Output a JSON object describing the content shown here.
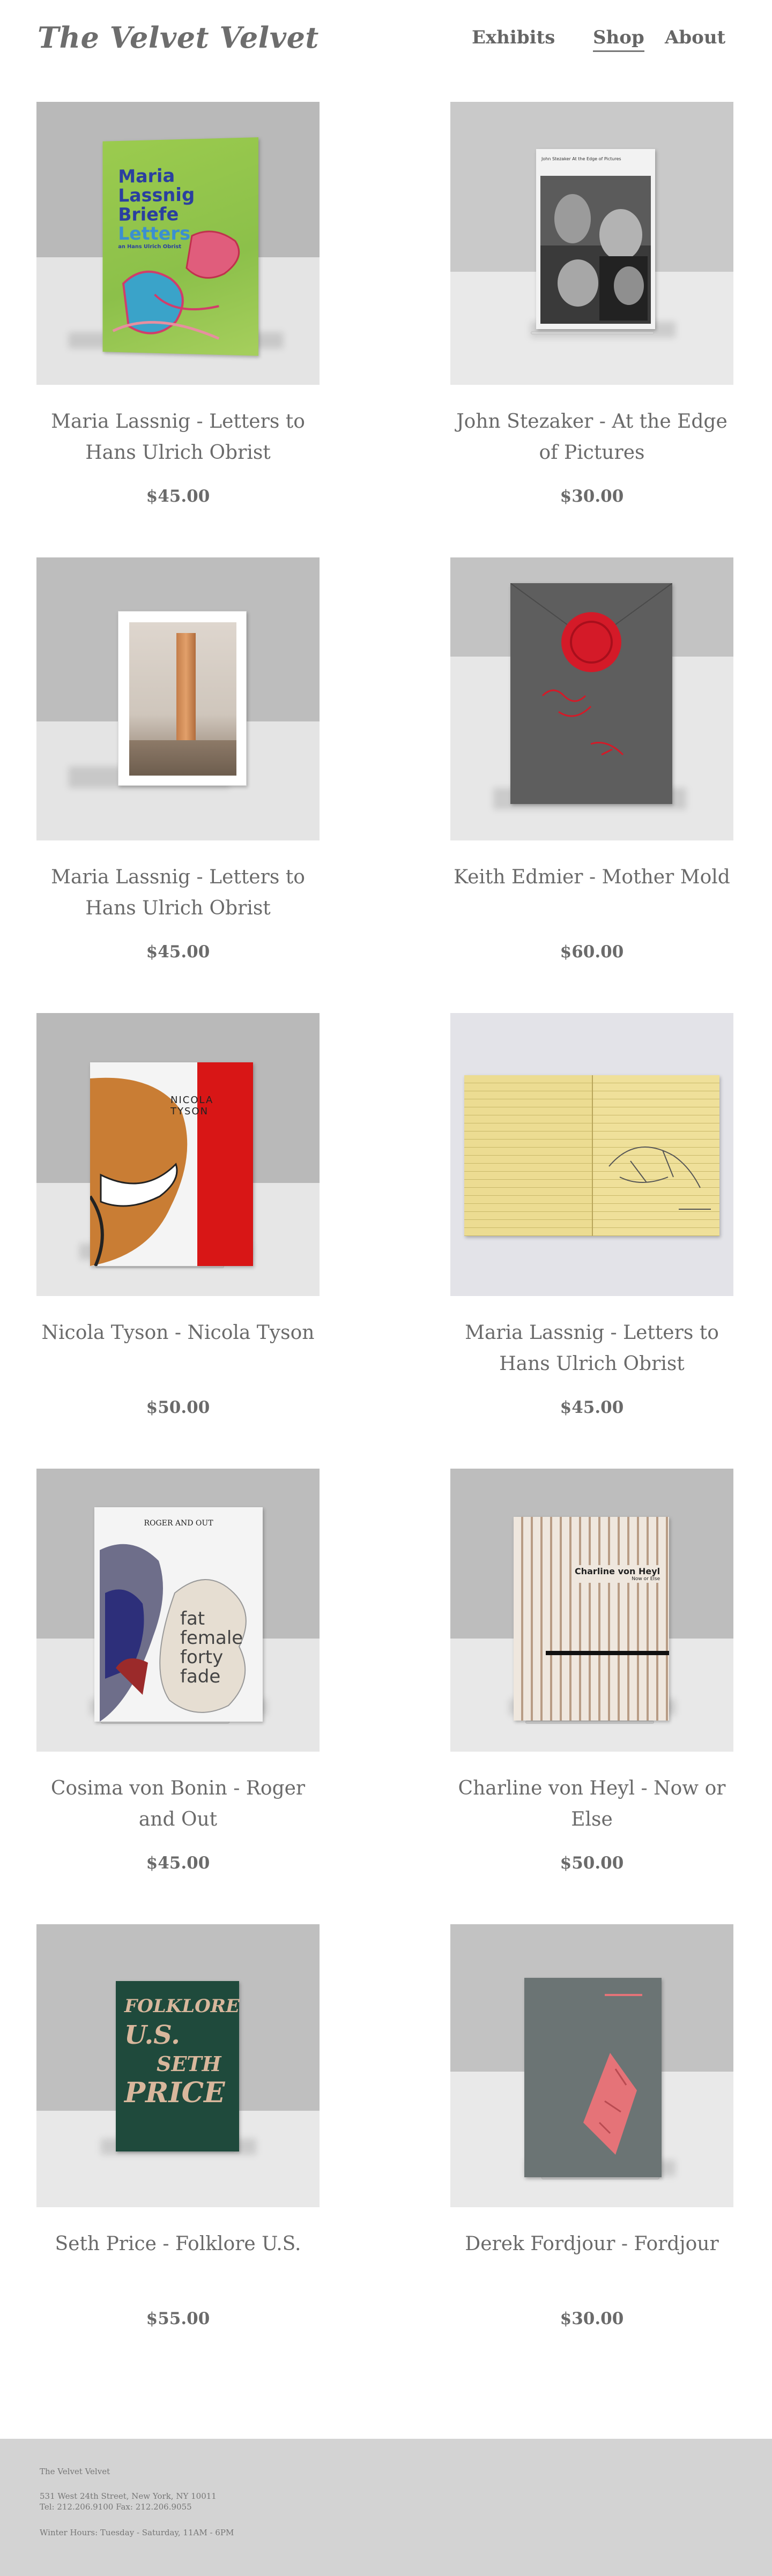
{
  "site": {
    "logo": "The Velvet Velvet"
  },
  "nav": {
    "items": [
      {
        "label": "Exhibits"
      },
      {
        "label": "Shop"
      },
      {
        "label": "About"
      }
    ],
    "active": "Shop"
  },
  "products": [
    {
      "title": "Maria Lassnig - Letters to Hans Ulrich Obrist",
      "price": "$45.00",
      "cover_text": [
        "Maria",
        "Lassnig",
        "Briefe",
        "Letters",
        "an Hans Ulrich Obrist"
      ]
    },
    {
      "title": "John Stezaker - At the Edge of Pictures",
      "price": "$30.00",
      "cover_text": [
        "John Stezaker At the Edge of Pictures"
      ]
    },
    {
      "title": "Maria Lassnig - Letters to Hans Ulrich Obrist",
      "price": "$45.00",
      "cover_text": []
    },
    {
      "title": "Keith Edmier - Mother Mold",
      "price": "$60.00",
      "cover_text": []
    },
    {
      "title": "Nicola Tyson - Nicola Tyson",
      "price": "$50.00",
      "cover_text": [
        "NICOLA TYSON"
      ]
    },
    {
      "title": "Maria Lassnig - Letters to Hans Ulrich Obrist",
      "price": "$45.00",
      "cover_text": []
    },
    {
      "title": "Cosima von Bonin - Roger and Out",
      "price": "$45.00",
      "cover_text": [
        "ROGER AND OUT",
        "fat",
        "female",
        "forty",
        "fade"
      ]
    },
    {
      "title": "Charline von Heyl - Now or Else",
      "price": "$50.00",
      "cover_text": [
        "Charline von Heyl",
        "Now or Else"
      ]
    },
    {
      "title": "Seth Price - Folklore U.S.",
      "price": "$55.00",
      "cover_text": [
        "FOLKLORE",
        "U.S.",
        "SETH",
        "PRICE"
      ]
    },
    {
      "title": "Derek Fordjour - Fordjour",
      "price": "$30.00",
      "cover_text": []
    }
  ],
  "footer": {
    "name": "The Velvet Velvet",
    "address": "531 West 24th Street, New York, NY 10011",
    "phone": "Tel: 212.206.9100 Fax: 212.206.9055",
    "hours": "Winter Hours: Tuesday - Saturday, 11AM - 6PM"
  }
}
